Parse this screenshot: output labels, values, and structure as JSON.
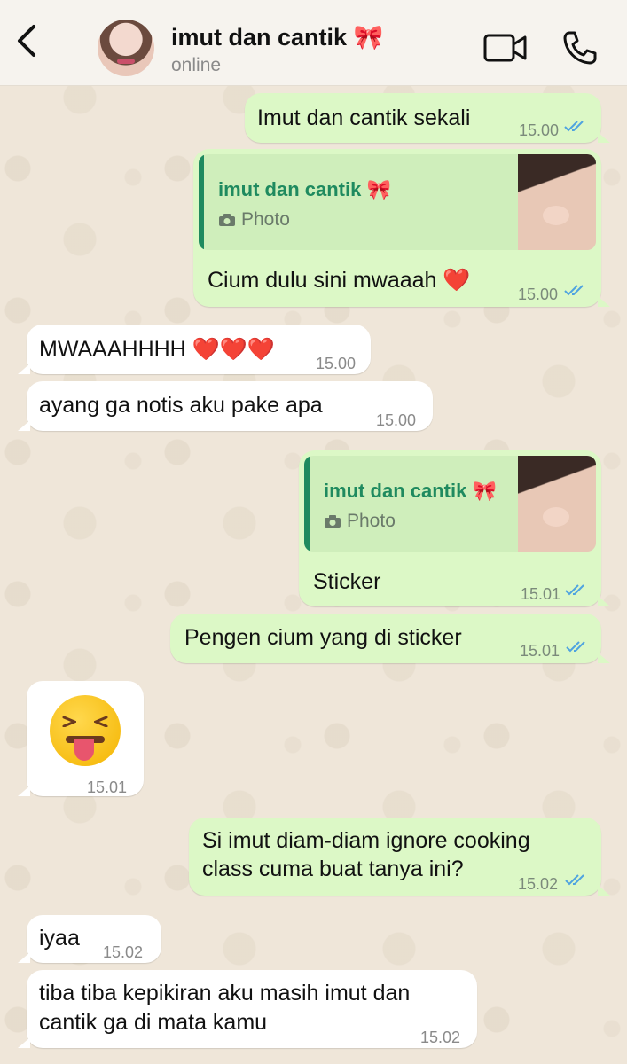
{
  "header": {
    "back_icon": "chevron-left-icon",
    "contact_name": "imut dan cantik 🎀",
    "status": "online",
    "video_icon": "video-camera-icon",
    "call_icon": "phone-icon"
  },
  "colors": {
    "outgoing_bubble": "#dcf8c6",
    "incoming_bubble": "#ffffff",
    "reply_accent": "#1f8a5f",
    "read_ticks": "#4fa3e0"
  },
  "messages": [
    {
      "dir": "out",
      "text": "Imut dan cantik sekali",
      "time": "15.00",
      "read": true
    },
    {
      "dir": "out",
      "reply": {
        "name": "imut dan cantik 🎀",
        "type": "Photo"
      },
      "text": "Cium dulu sini mwaaah ❤️",
      "time": "15.00",
      "read": true
    },
    {
      "dir": "in",
      "text": "MWAAAHHHH ❤️❤️❤️",
      "time": "15.00"
    },
    {
      "dir": "in",
      "text": "ayang ga notis aku pake apa",
      "time": "15.00"
    },
    {
      "dir": "out",
      "reply": {
        "name": "imut dan cantik 🎀",
        "type": "Photo"
      },
      "text": "Sticker",
      "time": "15.01",
      "read": true
    },
    {
      "dir": "out",
      "text": "Pengen cium yang di sticker",
      "time": "15.01",
      "read": true
    },
    {
      "dir": "in",
      "emoji": "squinting-face-with-tongue",
      "time": "15.01"
    },
    {
      "dir": "out",
      "lines": [
        "Si imut diam-diam ignore cooking",
        "class cuma buat tanya ini?"
      ],
      "time": "15.02",
      "read": true
    },
    {
      "dir": "in",
      "text": "iyaa",
      "time": "15.02"
    },
    {
      "dir": "in",
      "lines": [
        "tiba tiba kepikiran aku masih imut dan",
        "cantik ga di mata kamu"
      ],
      "time": "15.02"
    }
  ]
}
